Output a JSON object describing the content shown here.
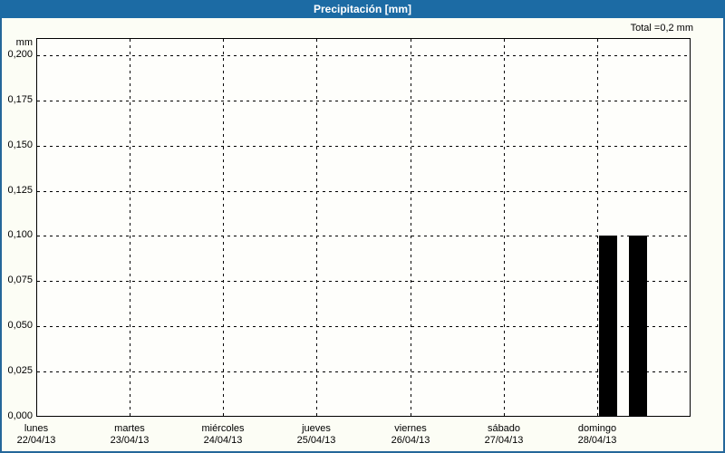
{
  "window": {
    "title": "Precipitación [mm]"
  },
  "chart_data": {
    "type": "bar",
    "title": "Precipitación [mm]",
    "unit_label": "mm",
    "total_text": "Total =0,2 mm",
    "total_value_mm": 0.2,
    "grid": true,
    "legend": false,
    "ylim": [
      0,
      0.2095
    ],
    "yticks": [
      {
        "value": 0.0,
        "label": "0,000"
      },
      {
        "value": 0.025,
        "label": "0,025"
      },
      {
        "value": 0.05,
        "label": "0,050"
      },
      {
        "value": 0.075,
        "label": "0,075"
      },
      {
        "value": 0.1,
        "label": "0,100"
      },
      {
        "value": 0.125,
        "label": "0,125"
      },
      {
        "value": 0.15,
        "label": "0,150"
      },
      {
        "value": 0.175,
        "label": "0,175"
      },
      {
        "value": 0.2,
        "label": "0,200"
      }
    ],
    "x_categories": [
      {
        "weekday": "lunes",
        "date": "22/04/13"
      },
      {
        "weekday": "martes",
        "date": "23/04/13"
      },
      {
        "weekday": "miércoles",
        "date": "24/04/13"
      },
      {
        "weekday": "jueves",
        "date": "25/04/13"
      },
      {
        "weekday": "viernes",
        "date": "26/04/13"
      },
      {
        "weekday": "sábado",
        "date": "27/04/13"
      },
      {
        "weekday": "domingo",
        "date": "28/04/13"
      }
    ],
    "bars": [
      {
        "weekday": "domingo",
        "date": "28/04/13",
        "value_mm": 0.1,
        "x_frac": 0.86,
        "width_frac": 0.0277
      },
      {
        "weekday": "domingo",
        "date": "28/04/13",
        "value_mm": 0.1,
        "x_frac": 0.9058,
        "width_frac": 0.0277
      }
    ]
  },
  "colors": {
    "titlebar_bg": "#1C6BA4",
    "titlebar_text": "#FFFFFF",
    "frame_border": "#24679A",
    "background": "#FCFDF5",
    "plot_background": "#FEFEFB",
    "grid": "#000000",
    "bar": "#000000"
  }
}
